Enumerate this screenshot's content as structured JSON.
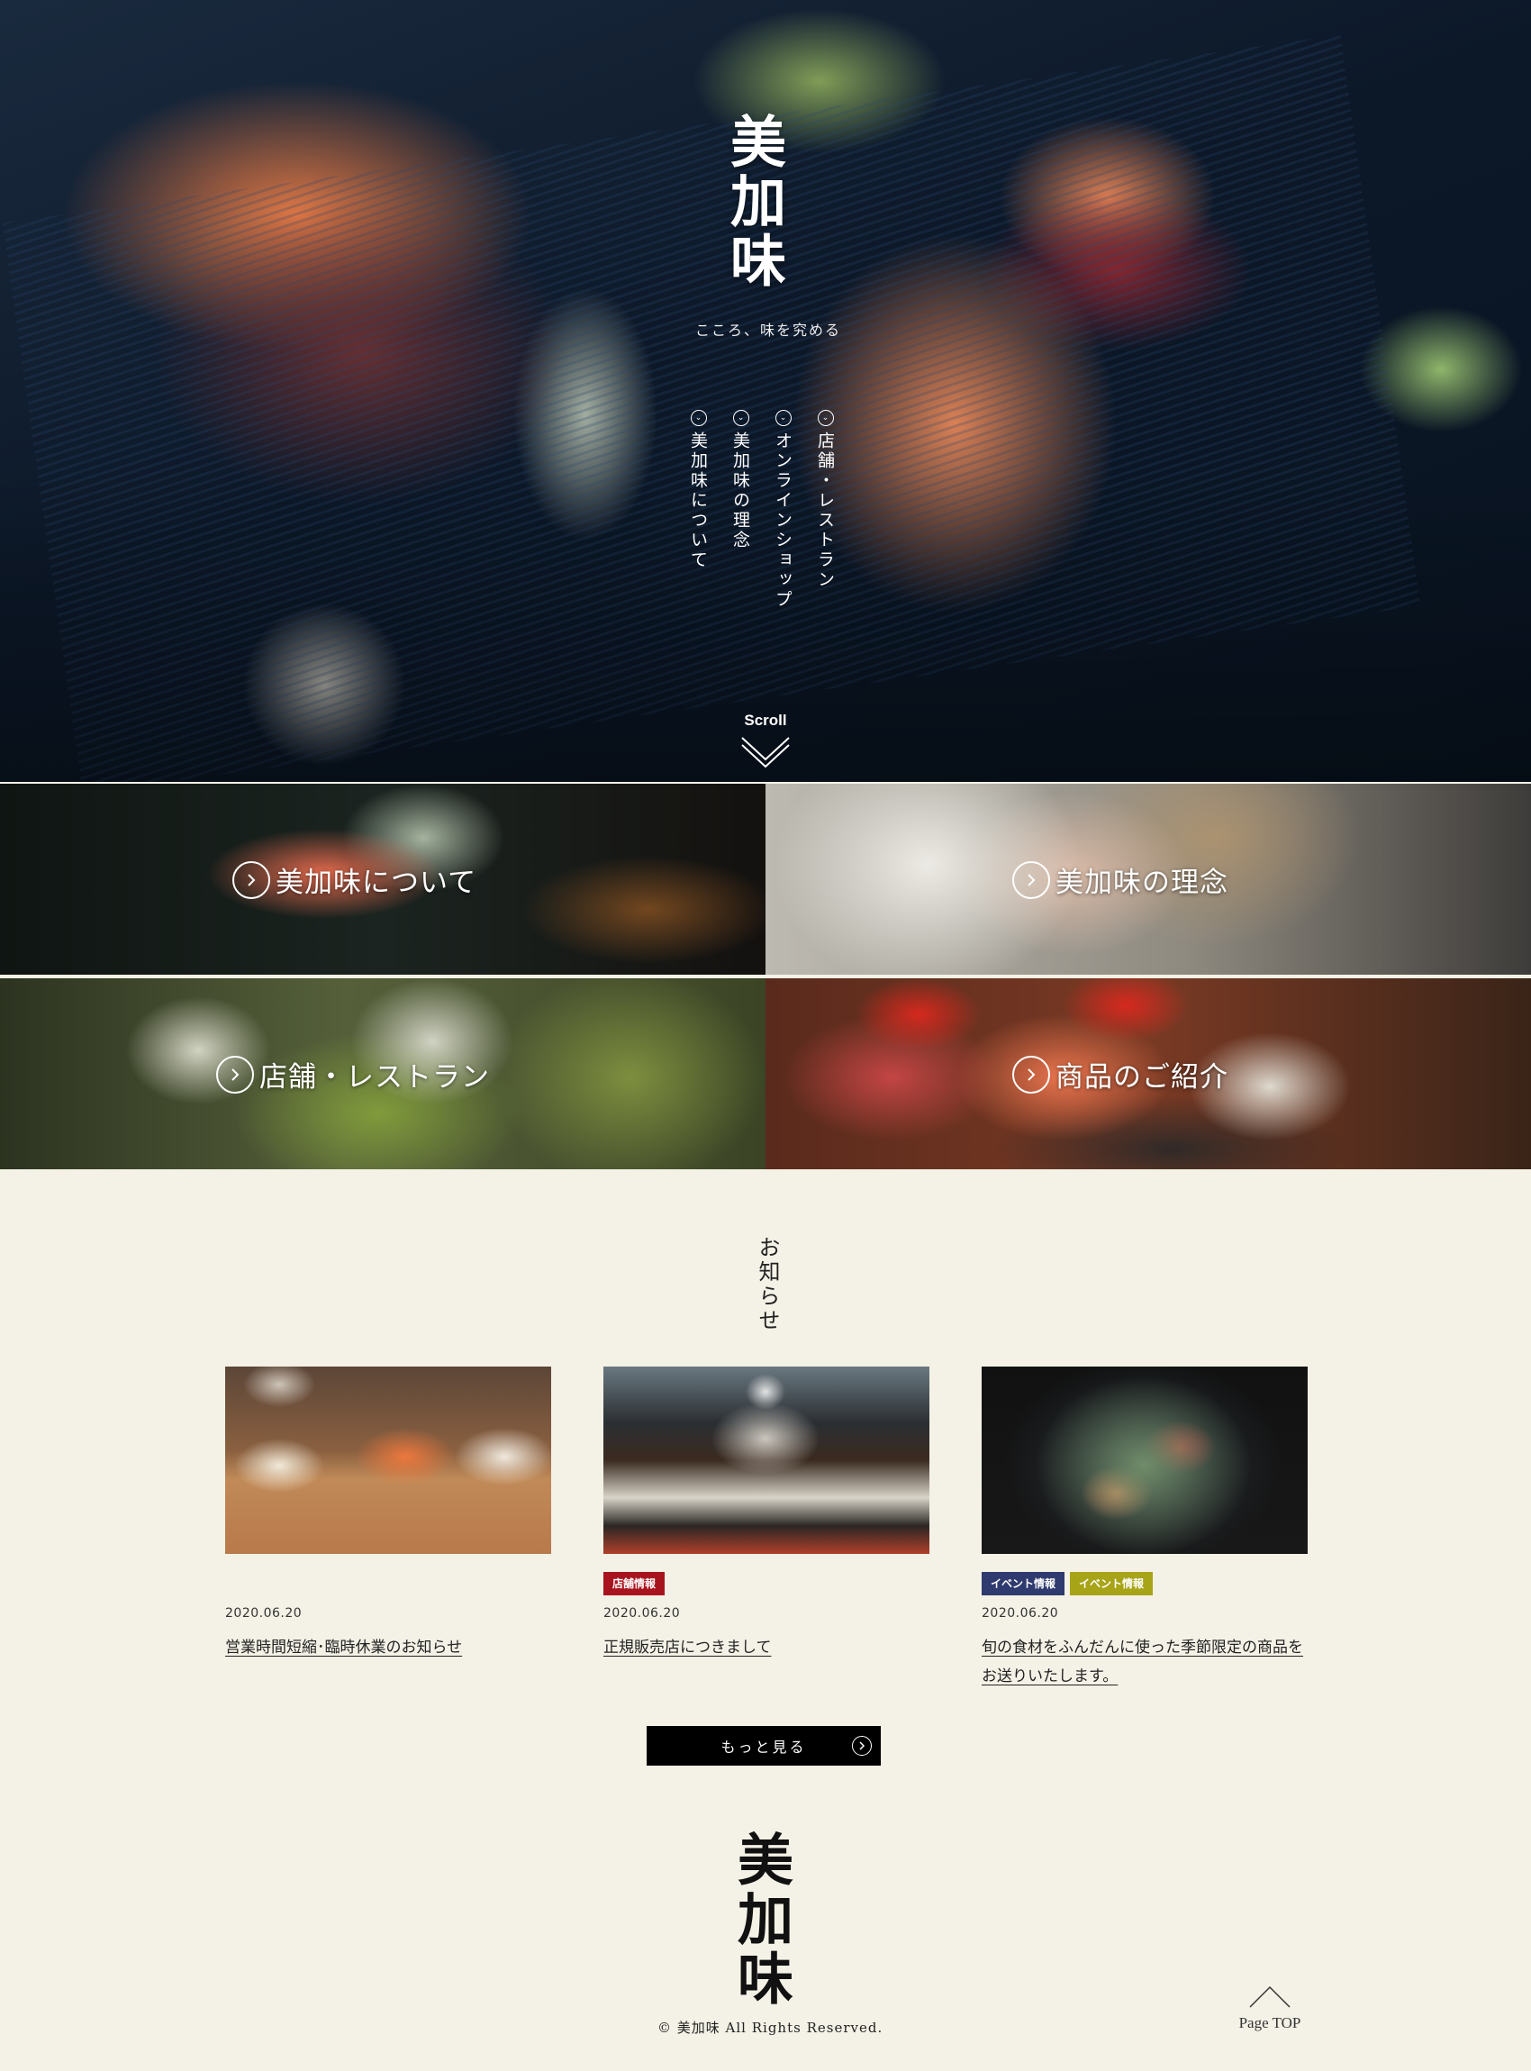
{
  "hero": {
    "logo": "美加味",
    "tagline": "こころ、味を究める",
    "nav": [
      {
        "label": "店舗・レストラン",
        "icon": "chevron-down-circle-icon"
      },
      {
        "label": "オンラインショップ",
        "icon": "chevron-down-circle-icon"
      },
      {
        "label": "美加味の理念",
        "icon": "chevron-down-circle-icon"
      },
      {
        "label": "美加味について",
        "icon": "chevron-down-circle-icon"
      }
    ],
    "scroll_label": "Scroll"
  },
  "tiles": [
    {
      "label": "美加味について",
      "icon": "chevron-right-circle-icon"
    },
    {
      "label": "美加味の理念",
      "icon": "chevron-right-circle-icon"
    },
    {
      "label": "店舗・レストラン",
      "icon": "chevron-right-circle-icon"
    },
    {
      "label": "商品のご紹介",
      "icon": "chevron-right-circle-icon"
    }
  ],
  "news": {
    "title": "お知らせ",
    "items": [
      {
        "tags": [],
        "date": "2020.06.20",
        "title": "営業時間短縮･臨時休業のお知らせ"
      },
      {
        "tags": [
          {
            "label": "店舗情報",
            "color": "#a8141e"
          }
        ],
        "date": "2020.06.20",
        "title": "正規販売店につきまして"
      },
      {
        "tags": [
          {
            "label": "イベント情報",
            "color": "#2f3a6e"
          },
          {
            "label": "イベント情報",
            "color": "#a8a418"
          }
        ],
        "date": "2020.06.20",
        "title": "旬の食材をふんだんに使った季節限定の商品をお送りいたします。"
      }
    ],
    "more_label": "もっと見る"
  },
  "footer": {
    "logo": "美加味",
    "copyright": "© 美加味 All Rights Reserved.",
    "page_top": "Page TOP"
  },
  "colors": {
    "background": "#f4f1e6",
    "button": "#000000",
    "tag_store": "#a8141e",
    "tag_event_navy": "#2f3a6e",
    "tag_event_olive": "#a8a418"
  }
}
